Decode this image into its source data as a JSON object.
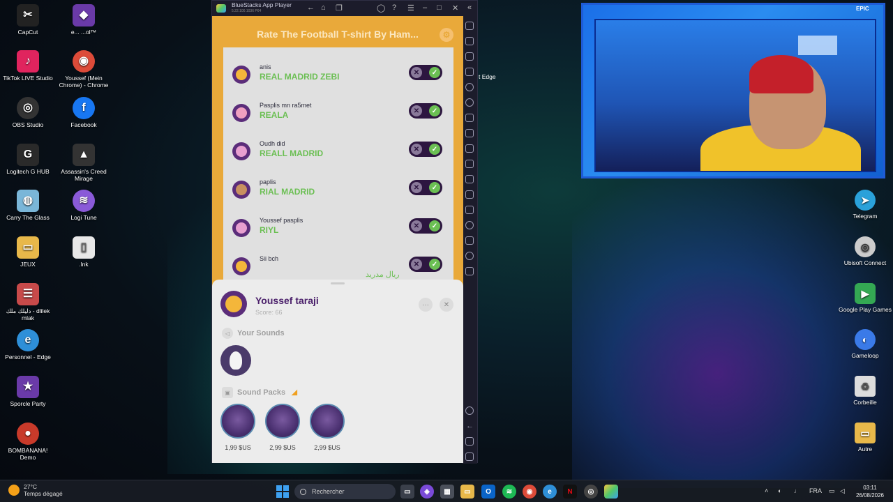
{
  "desktop": {
    "left_col1": [
      {
        "label": "CapCut",
        "icon": "capcut-icon",
        "color": "#222222"
      },
      {
        "label": "TikTok LIVE Studio",
        "icon": "tiktok-icon",
        "color": "#e0245e"
      },
      {
        "label": "OBS Studio",
        "icon": "obs-icon",
        "color": "#333333"
      },
      {
        "label": "Logitech G HUB",
        "icon": "logitech-icon",
        "color": "#2a2a2a"
      },
      {
        "label": "Carry The Glass",
        "icon": "carry-glass-icon",
        "color": "#7ab6d8"
      },
      {
        "label": "JEUX",
        "icon": "folder-icon",
        "color": "#e8b84a"
      },
      {
        "label": "دليلك ملك - dlilek mlak",
        "icon": "dlilek-icon",
        "color": "#c84a4a"
      },
      {
        "label": "Personnel - Edge",
        "icon": "edge-icon",
        "color": "#2e8fd8"
      },
      {
        "label": "Sporcle Party",
        "icon": "sporcle-icon",
        "color": "#6a3aa8"
      },
      {
        "label": "BOMBANANA! Demo",
        "icon": "bombanana-icon",
        "color": "#c83a2a"
      }
    ],
    "left_col2": [
      {
        "label": "e... ...ol™",
        "icon": "game-icon",
        "color": "#6a3aa8"
      },
      {
        "label": "Youssef (Mein Chrome) - Chrome",
        "icon": "chrome-icon",
        "color": "#dd4b39"
      },
      {
        "label": "Facebook",
        "icon": "facebook-icon",
        "color": "#1877f2"
      },
      {
        "label": "Assassin's Creed Mirage",
        "icon": "assassins-creed-icon",
        "color": "#333333"
      },
      {
        "label": "Logi Tune",
        "icon": "logi-tune-icon",
        "color": "#8a5ad8"
      },
      {
        "label": ".lnk",
        "icon": "file-icon",
        "color": "#e8e8e8"
      }
    ],
    "right_col": [
      {
        "label": "Telegram",
        "icon": "telegram-icon",
        "color": "#2aa1da"
      },
      {
        "label": "Ubisoft Connect",
        "icon": "ubisoft-icon",
        "color": "#cccccc"
      },
      {
        "label": "Google Play Games",
        "icon": "google-play-games-icon",
        "color": "#34a853"
      },
      {
        "label": "Gameloop",
        "icon": "gameloop-icon",
        "color": "#3a7ae8"
      },
      {
        "label": "Corbeille",
        "icon": "recycle-bin-icon",
        "color": "#dddddd"
      },
      {
        "label": "Autre",
        "icon": "folder-icon",
        "color": "#e8b84a"
      }
    ],
    "edge_label": "t Edge",
    "epic_label": "EPIC"
  },
  "bluestacks": {
    "title": "BlueStacks App Player",
    "version": "5.22.100.1036 P64",
    "app_title": "Rate The Football T-shirt By Ham...",
    "entries": [
      {
        "user": "anis",
        "answer": "REAL MADRID ZEBI",
        "arabic": false
      },
      {
        "user": "Pasplis mn ra5met",
        "answer": "REALA",
        "arabic": false
      },
      {
        "user": "Oudh did",
        "answer": "REALL MADRID",
        "arabic": false
      },
      {
        "user": "paplis",
        "answer": "RIAL MADRID",
        "arabic": false
      },
      {
        "user": "Youssef pasplis",
        "answer": "RIYL",
        "arabic": false
      },
      {
        "user": "Sii bch",
        "answer": "ريال مدريد",
        "arabic": true
      }
    ],
    "profile": {
      "name": "Youssef taraji",
      "score": "Score: 66",
      "your_sounds": "Your Sounds",
      "sound_packs": "Sound Packs",
      "packs": [
        {
          "price": "1,99 $US"
        },
        {
          "price": "2,99 $US"
        },
        {
          "price": "2,99 $US"
        }
      ]
    }
  },
  "taskbar": {
    "temp": "27°C",
    "weather": "Temps dégagé",
    "search_placeholder": "Rechercher",
    "lang": "FRA",
    "time": "03:11",
    "date": "26/08/2026"
  },
  "colors": {
    "app_orange": "#e9a93a",
    "accent_purple": "#4a1f6a",
    "answer_green": "#6bbf53"
  }
}
